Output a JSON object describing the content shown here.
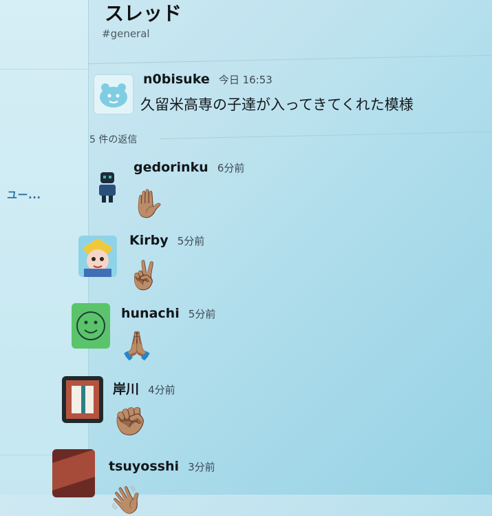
{
  "sidebar": {
    "item_label": "ユー..."
  },
  "thread": {
    "title": "スレッド",
    "channel": "#general",
    "parent": {
      "author": "n0bisuke",
      "time": "今日 16:53",
      "text": "久留米高専の子達が入ってきてくれた模様"
    },
    "reply_count_label": "5 件の返信",
    "replies": [
      {
        "author": "gedorinku",
        "time": "6分前",
        "emoji": "✋🏽"
      },
      {
        "author": "Kirby",
        "time": "5分前",
        "emoji": "✌🏽"
      },
      {
        "author": "hunachi",
        "time": "5分前",
        "emoji": "🙏🏽"
      },
      {
        "author": "岸川",
        "time": "4分前",
        "emoji": "✊🏽"
      },
      {
        "author": "tsuyosshi",
        "time": "3分前",
        "emoji": "👋🏽"
      }
    ]
  },
  "colors": {
    "background": "#aadbea",
    "sidebar_link": "#2f6fa3",
    "text": "#1c1d22"
  }
}
